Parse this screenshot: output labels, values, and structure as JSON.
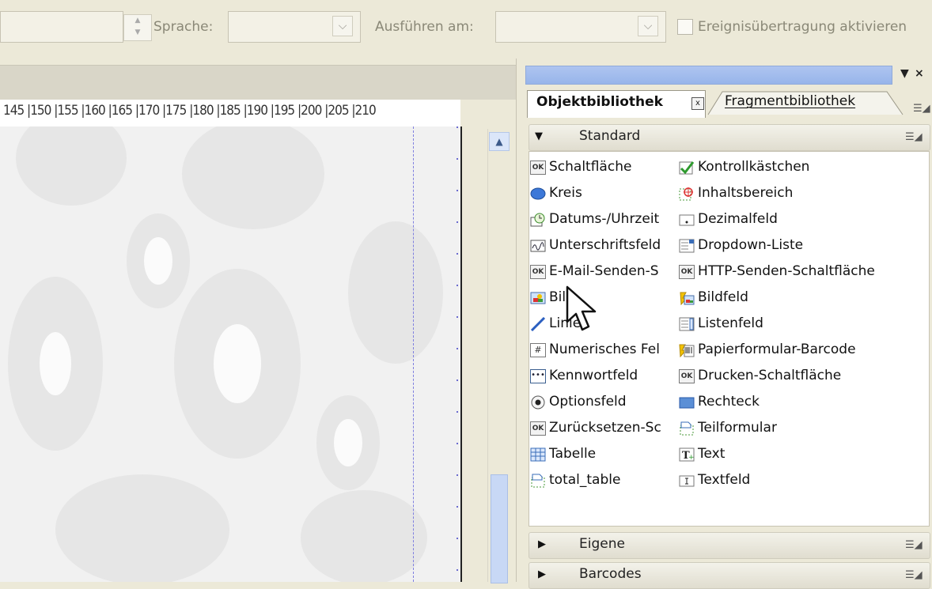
{
  "toolbar": {
    "language_label": "Sprache:",
    "execute_label": "Ausführen am:",
    "event_label": "Ereignisübertragung aktivieren"
  },
  "ruler": {
    "marks": "145 |150 |155 |160 |165 |170 |175 |180 |185 |190 |195 |200 |205 |210"
  },
  "panel": {
    "tabs": [
      "Objektbibliothek",
      "Fragmentbibliothek"
    ],
    "close_glyph": "x",
    "window_controls": [
      "▼",
      "×"
    ],
    "sections": {
      "standard": "Standard",
      "eigene": "Eigene",
      "barcodes": "Barcodes"
    },
    "items_left": [
      "Schaltfläche",
      "Kreis",
      "Datums-/Uhrzeit",
      "Unterschriftsfeld",
      "E-Mail-Senden-S",
      "Bild",
      "Linie",
      "Numerisches Fel",
      "Kennwortfeld",
      "Optionsfeld",
      "Zurücksetzen-Sc",
      "Tabelle",
      "total_table"
    ],
    "items_right": [
      "Kontrollkästchen",
      "Inhaltsbereich",
      "Dezimalfeld",
      "Dropdown-Liste",
      "HTTP-Senden-Schaltfläche",
      "Bildfeld",
      "Listenfeld",
      "Papierformular-Barcode",
      "Drucken-Schaltfläche",
      "Rechteck",
      "Teilformular",
      "Text",
      "Textfeld"
    ],
    "icons_left": [
      "ok-button-icon",
      "circle-icon",
      "clock-icon",
      "signature-icon",
      "ok-button-icon",
      "image-icon",
      "line-icon",
      "numeric-field-icon",
      "password-field-icon",
      "radio-button-icon",
      "ok-button-icon",
      "table-icon",
      "subform-icon"
    ],
    "icons_right": [
      "checkbox-icon",
      "content-area-icon",
      "decimal-field-icon",
      "dropdown-list-icon",
      "ok-button-icon",
      "image-field-icon",
      "list-box-icon",
      "paper-barcode-icon",
      "ok-button-icon",
      "rectangle-icon",
      "subform-icon",
      "text-icon",
      "text-field-icon"
    ]
  },
  "colors": {
    "chrome": "#ece9d8",
    "panel_title": "#98b5ea",
    "accent_blue": "#3c78d8"
  }
}
